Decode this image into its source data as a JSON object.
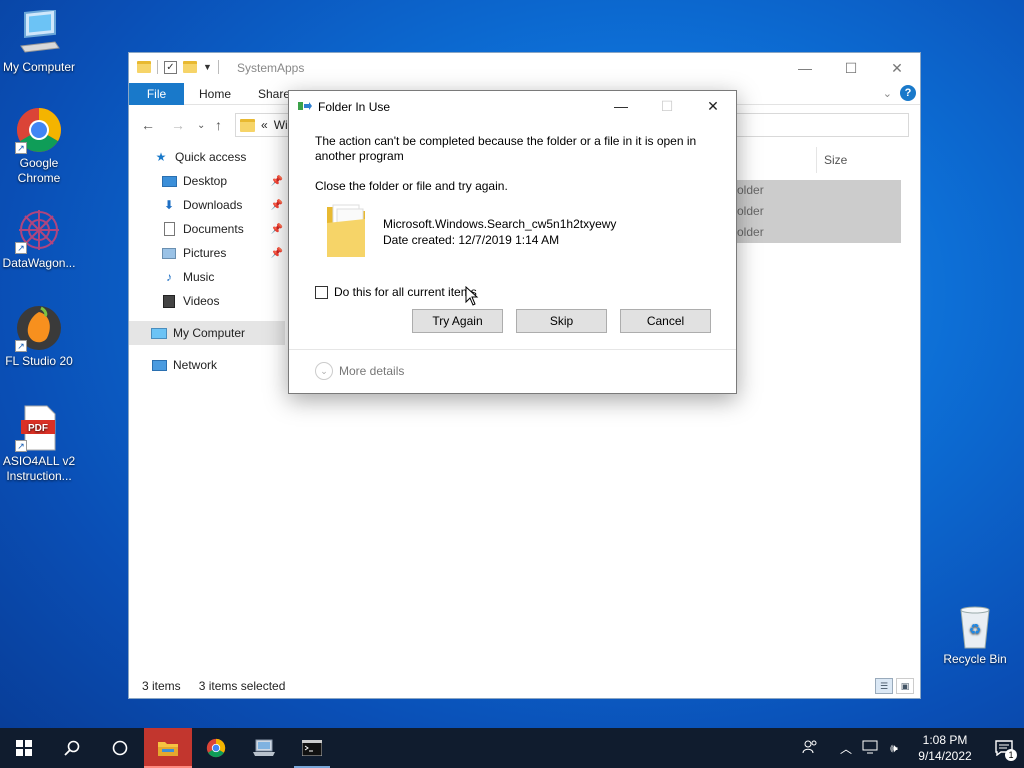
{
  "desktop": {
    "icons": [
      {
        "label": "My Computer",
        "icon": "computer-icon"
      },
      {
        "label": "Google Chrome",
        "icon": "chrome-icon"
      },
      {
        "label": "DataWagon...",
        "icon": "datawagon-icon"
      },
      {
        "label": "FL Studio 20",
        "icon": "fl-studio-icon"
      },
      {
        "label": "ASIO4ALL v2 Instruction...",
        "icon": "pdf-icon",
        "badge": "PDF"
      },
      {
        "label": "Recycle Bin",
        "icon": "recycle-bin-icon"
      }
    ]
  },
  "explorer": {
    "title": "SystemApps",
    "ribbon": {
      "file": "File",
      "home": "Home",
      "share": "Share",
      "help": "?"
    },
    "address": {
      "prefix": "«",
      "path": "Wi"
    },
    "sidebar": {
      "quick_access": "Quick access",
      "items": [
        {
          "label": "Desktop",
          "pinned": true
        },
        {
          "label": "Downloads",
          "pinned": true
        },
        {
          "label": "Documents",
          "pinned": true
        },
        {
          "label": "Pictures",
          "pinned": true
        },
        {
          "label": "Music",
          "pinned": false
        },
        {
          "label": "Videos",
          "pinned": false
        }
      ],
      "my_computer": "My Computer",
      "network": "Network"
    },
    "column_size": "Size",
    "rows": [
      "older",
      "older",
      "older"
    ],
    "status": {
      "count": "3 items",
      "selected": "3 items selected"
    }
  },
  "dialog": {
    "title": "Folder In Use",
    "message": "The action can't be completed because the folder or a file in it is open in another program",
    "instruction": "Close the folder or file and try again.",
    "item_name": "Microsoft.Windows.Search_cw5n1h2txyewy",
    "item_date": "Date created: 12/7/2019 1:14 AM",
    "checkbox_label": "Do this for all current items",
    "buttons": {
      "try_again": "Try Again",
      "skip": "Skip",
      "cancel": "Cancel"
    },
    "more_details": "More details"
  },
  "taskbar": {
    "time": "1:08 PM",
    "date": "9/14/2022",
    "notification_count": "1"
  },
  "colors": {
    "accent": "#1979ca",
    "taskbar": "#101c2e",
    "active_task": "#c2362e"
  }
}
